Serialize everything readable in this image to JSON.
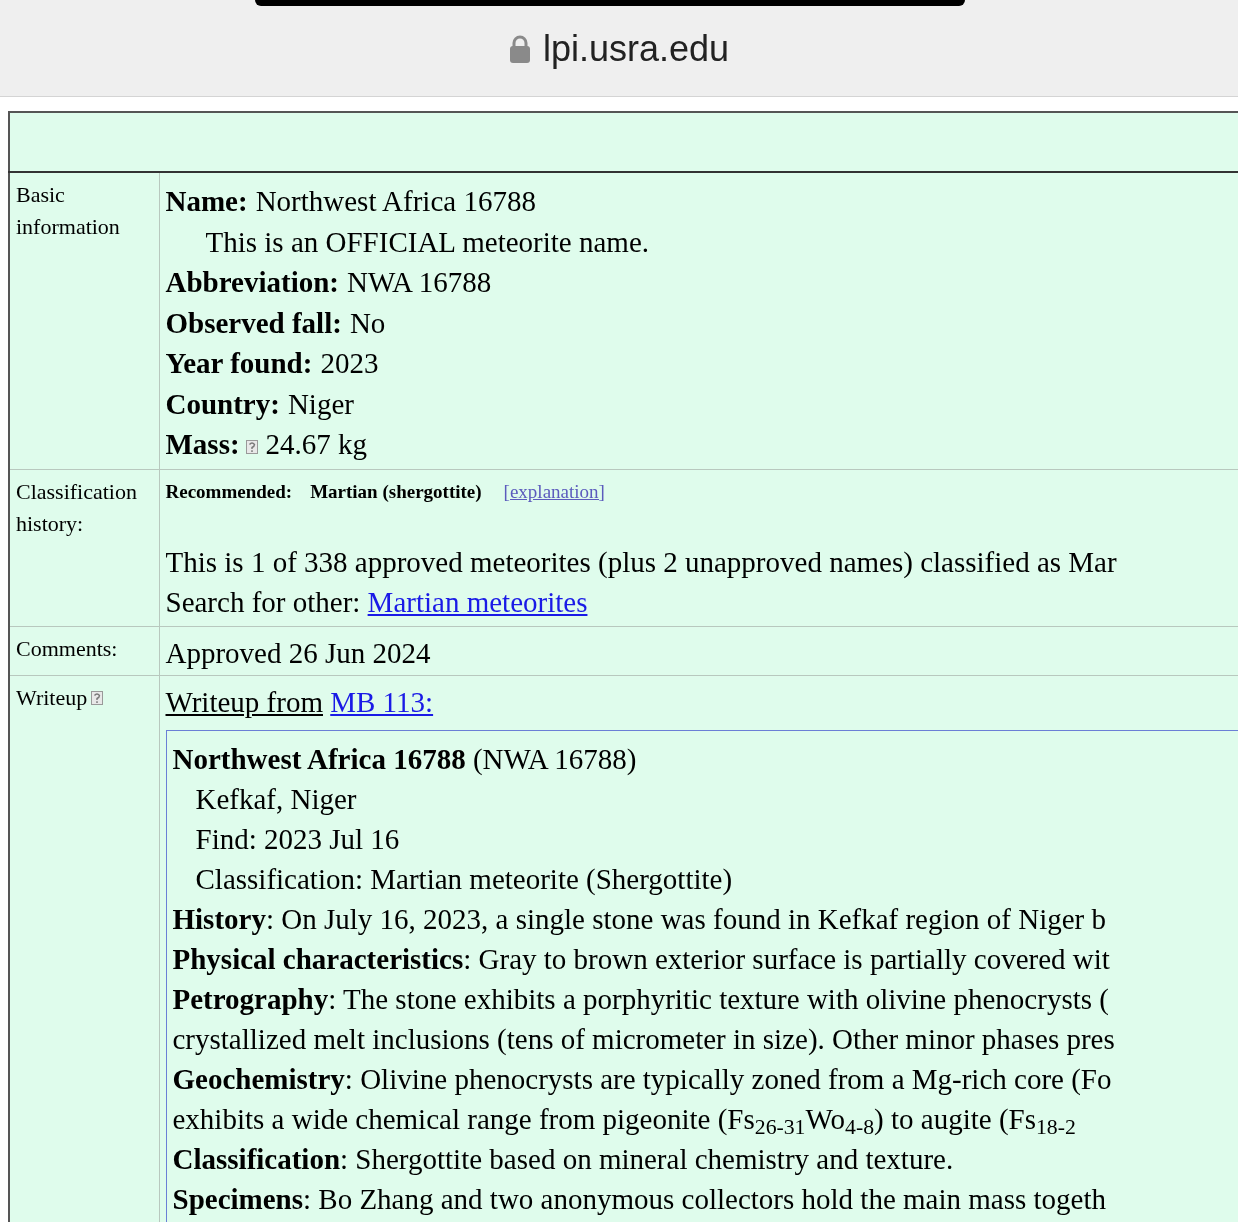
{
  "browser": {
    "url": "lpi.usra.edu"
  },
  "basic": {
    "label": "Basic information",
    "fields": [
      {
        "kind": "field",
        "key": "Name:",
        "value": "Northwest Africa 16788",
        "help": false
      },
      {
        "kind": "note",
        "value": "This is an OFFICIAL meteorite name."
      },
      {
        "kind": "field",
        "key": "Abbreviation:",
        "value": "NWA 16788",
        "help": false
      },
      {
        "kind": "field",
        "key": "Observed fall:",
        "value": "No",
        "help": false
      },
      {
        "kind": "field",
        "key": "Year found:",
        "value": "2023",
        "help": false
      },
      {
        "kind": "field",
        "key": "Country:",
        "value": "Niger",
        "help": false
      },
      {
        "kind": "field",
        "key": "Mass:",
        "value": "24.67 kg",
        "help": true
      }
    ]
  },
  "classification": {
    "label": "Classification history:",
    "recommended_label": "Recommended:",
    "recommended_value": "Martian (shergottite)",
    "explanation_link": "[explanation]",
    "summary": "This is 1 of 338 approved meteorites (plus 2 unapproved names) classified as Mar",
    "search_label": "Search for other:",
    "search_link": "Martian meteorites"
  },
  "comments": {
    "label": "Comments:",
    "text": "Approved 26 Jun 2024"
  },
  "writeup": {
    "label": "Writeup",
    "help": true,
    "lead": "Writeup from",
    "source_link": "MB 113:",
    "lines": [
      {
        "kind": "plain",
        "text": "**Northwest Africa 16788** (NWA 16788)"
      },
      {
        "kind": "indent",
        "text": "Kefkaf, Niger"
      },
      {
        "kind": "indent",
        "text": "Find: 2023 Jul 16"
      },
      {
        "kind": "indent",
        "text": "Classification: Martian meteorite (Shergottite)"
      },
      {
        "kind": "plain",
        "text": "**History**: On July 16, 2023, a single stone was found in Kefkaf region of Niger b"
      },
      {
        "kind": "plain",
        "text": "**Physical characteristics**: Gray to brown exterior surface is partially covered wit"
      },
      {
        "kind": "plain",
        "text": "**Petrography**: The stone exhibits a porphyritic texture with olivine phenocrysts ("
      },
      {
        "kind": "plain",
        "text": "crystallized melt inclusions (tens of micrometer in size). Other minor phases pres"
      },
      {
        "kind": "plain",
        "text": "**Geochemistry**: Olivine phenocrysts are typically zoned from a Mg-rich core (Fo"
      },
      {
        "kind": "plain",
        "text": "exhibits a wide chemical range from pigeonite (Fs$_{26-31}$Wo$_{4-8}$) to augite (Fs$_{18-2}$"
      },
      {
        "kind": "plain",
        "text": "**Classification**: Shergottite based on mineral chemistry and texture."
      },
      {
        "kind": "plain",
        "text": "**Specimens**: Bo Zhang and two anonymous collectors hold the main mass togeth"
      }
    ]
  }
}
